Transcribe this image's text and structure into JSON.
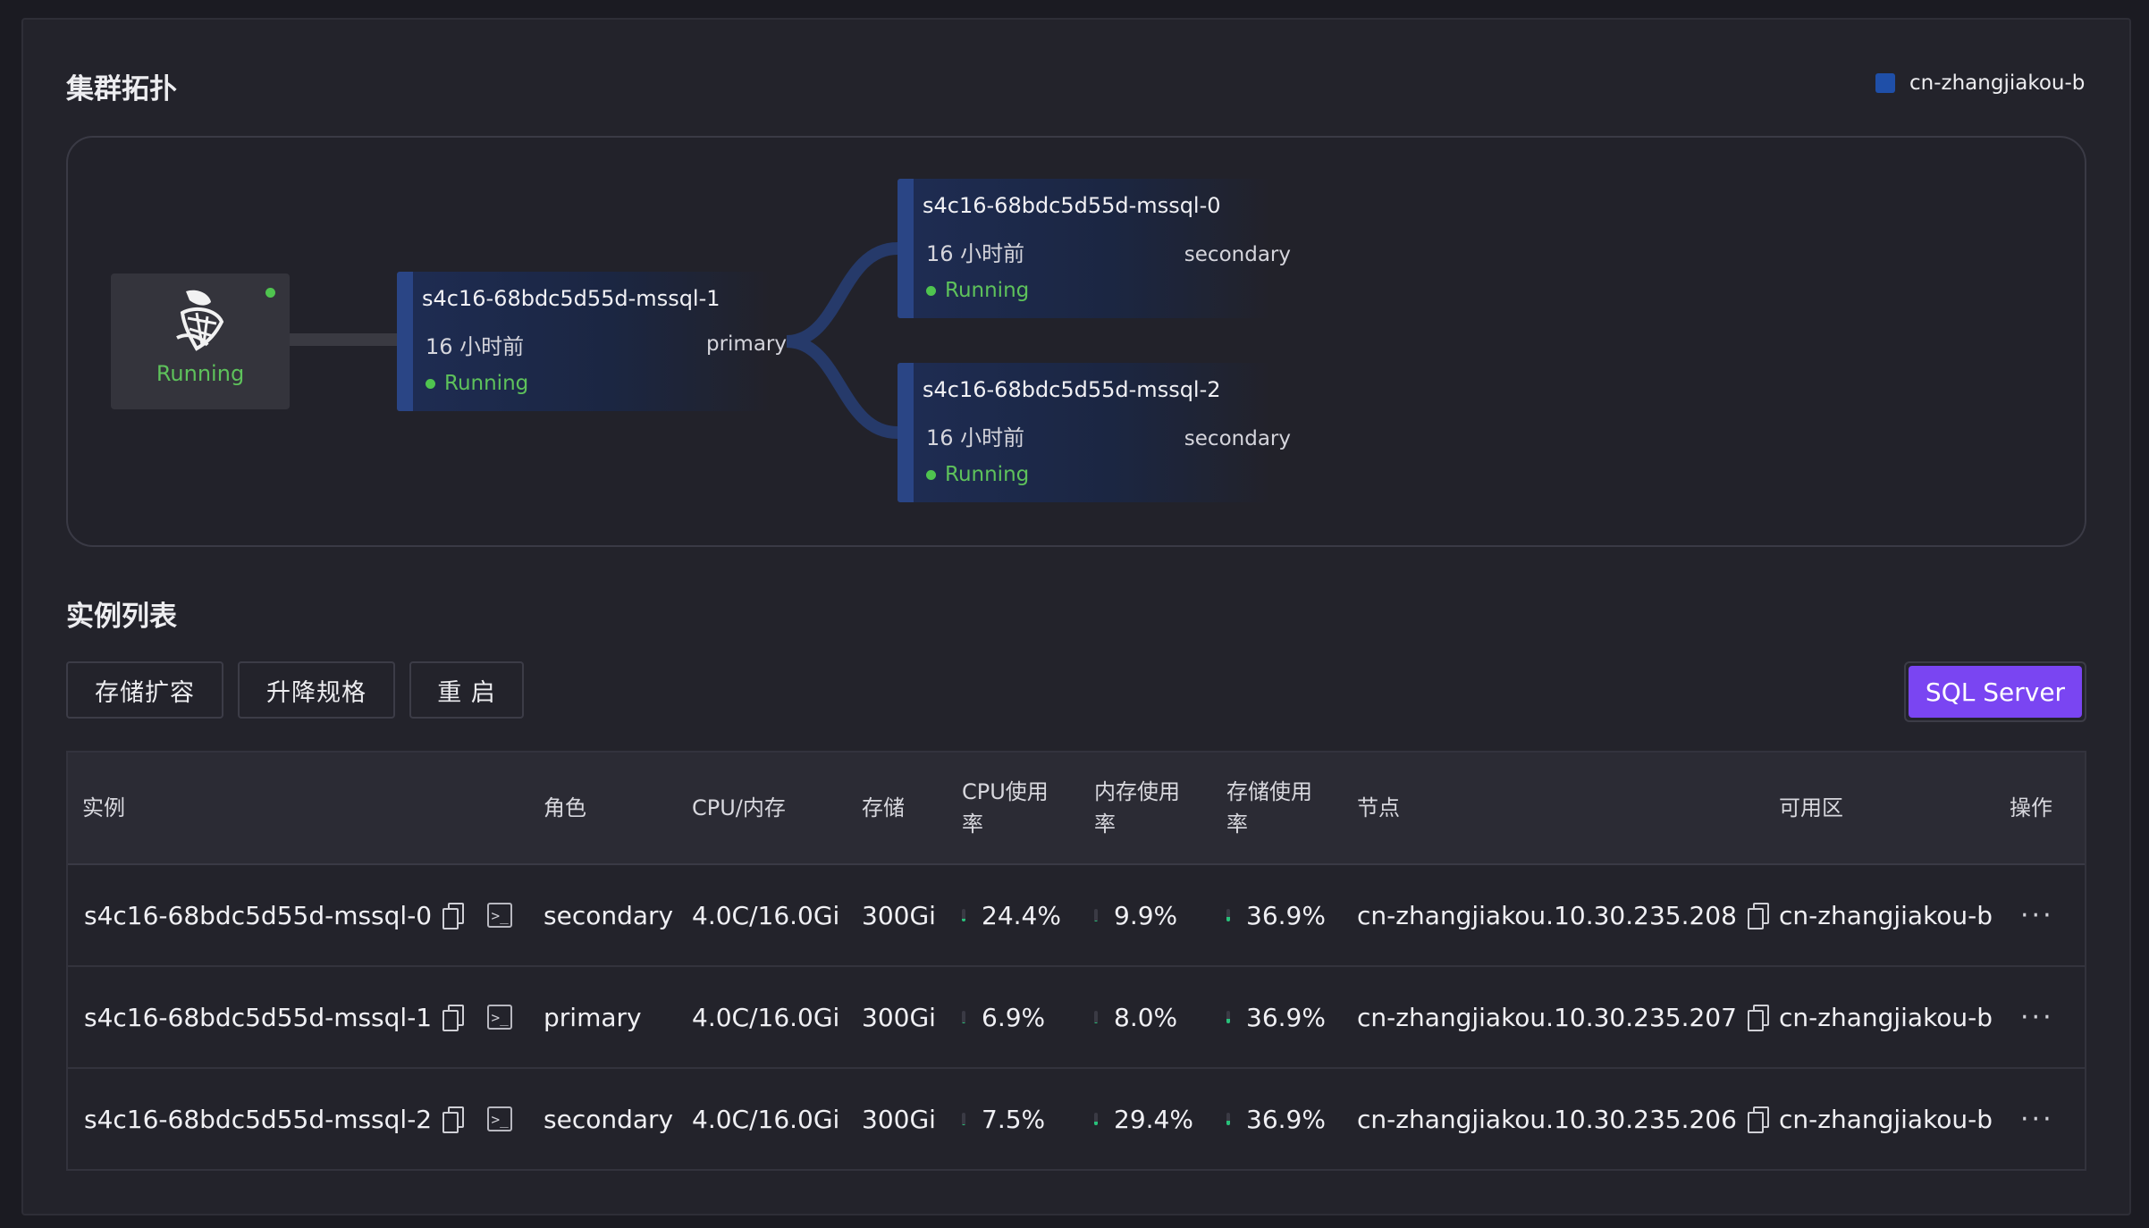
{
  "topology": {
    "title": "集群拓扑",
    "zone_legend": "cn-zhangjiakou-b",
    "root": {
      "status": "Running"
    },
    "pods": [
      {
        "name": "s4c16-68bdc5d55d-mssql-1",
        "age": "16 小时前",
        "role": "primary",
        "status": "Running"
      },
      {
        "name": "s4c16-68bdc5d55d-mssql-0",
        "age": "16 小时前",
        "role": "secondary",
        "status": "Running"
      },
      {
        "name": "s4c16-68bdc5d55d-mssql-2",
        "age": "16 小时前",
        "role": "secondary",
        "status": "Running"
      }
    ]
  },
  "instances": {
    "title": "实例列表",
    "actions": {
      "expand_storage": "存储扩容",
      "change_spec": "升降规格",
      "restart": "重 启"
    },
    "engine_button": "SQL Server",
    "columns": {
      "instance": "实例",
      "role": "角色",
      "cpu_mem": "CPU/内存",
      "storage": "存储",
      "cpu_usage_1": "CPU使用",
      "cpu_usage_2": "率",
      "mem_usage_1": "内存使用",
      "mem_usage_2": "率",
      "disk_usage_1": "存储使用",
      "disk_usage_2": "率",
      "node": "节点",
      "zone": "可用区",
      "ops": "操作"
    },
    "rows": [
      {
        "name": "s4c16-68bdc5d55d-mssql-0",
        "role": "secondary",
        "cpu_mem": "4.0C/16.0Gi",
        "storage": "300Gi",
        "cpu_usage": "24.4%",
        "cpu_frac": 0.244,
        "mem_usage": "9.9%",
        "mem_frac": 0.099,
        "disk_usage": "36.9%",
        "disk_frac": 0.369,
        "node": "cn-zhangjiakou.10.30.235.208",
        "zone": "cn-zhangjiakou-b",
        "more": "···"
      },
      {
        "name": "s4c16-68bdc5d55d-mssql-1",
        "role": "primary",
        "cpu_mem": "4.0C/16.0Gi",
        "storage": "300Gi",
        "cpu_usage": "6.9%",
        "cpu_frac": 0.069,
        "mem_usage": "8.0%",
        "mem_frac": 0.08,
        "disk_usage": "36.9%",
        "disk_frac": 0.369,
        "node": "cn-zhangjiakou.10.30.235.207",
        "zone": "cn-zhangjiakou-b",
        "more": "···"
      },
      {
        "name": "s4c16-68bdc5d55d-mssql-2",
        "role": "secondary",
        "cpu_mem": "4.0C/16.0Gi",
        "storage": "300Gi",
        "cpu_usage": "7.5%",
        "cpu_frac": 0.075,
        "mem_usage": "29.4%",
        "mem_frac": 0.294,
        "disk_usage": "36.9%",
        "disk_frac": 0.369,
        "node": "cn-zhangjiakou.10.30.235.206",
        "zone": "cn-zhangjiakou-b",
        "more": "···"
      }
    ]
  },
  "colors": {
    "accent": "#7a45f2",
    "running": "#5ec25b",
    "usage_fill": "#28c17a",
    "zone": "#1f4fa8"
  },
  "icons": {
    "copy": "copy-icon",
    "terminal": "terminal-icon",
    "more": "more-icon",
    "logo": "sql-server-logo"
  }
}
